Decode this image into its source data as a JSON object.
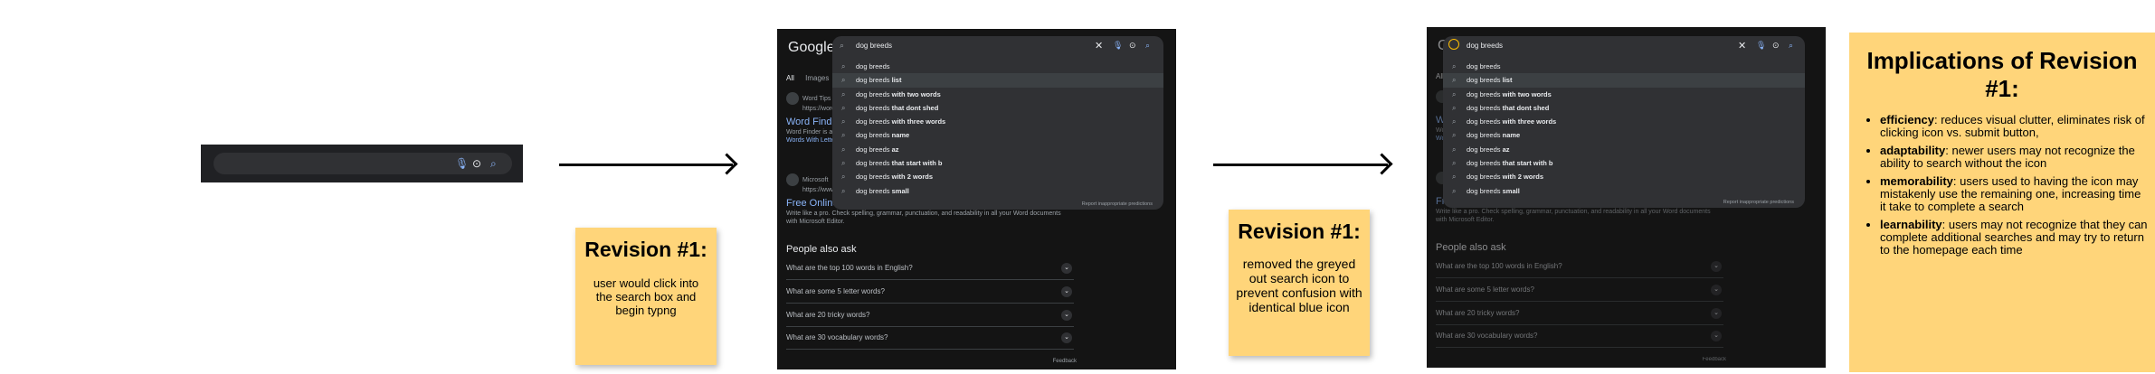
{
  "stage1": {
    "icons": [
      "mic-icon",
      "lens-icon",
      "search-icon"
    ]
  },
  "note1": {
    "heading": "Revision #1:",
    "body": "user would click into the search box and begin typng"
  },
  "note2": {
    "heading": "Revision #1:",
    "body": "removed the greyed out search icon to prevent confusion with identical blue icon"
  },
  "screen": {
    "logo": "Google",
    "query": "dog breeds",
    "tabs": [
      "All",
      "Images"
    ],
    "suggestions": [
      {
        "prefix": "dog breeds",
        "bold": ""
      },
      {
        "prefix": "dog breeds",
        "bold": " list"
      },
      {
        "prefix": "dog breeds",
        "bold": " with two words"
      },
      {
        "prefix": "dog breeds",
        "bold": " that dont shed"
      },
      {
        "prefix": "dog breeds",
        "bold": " with three words"
      },
      {
        "prefix": "dog breeds",
        "bold": " name"
      },
      {
        "prefix": "dog breeds",
        "bold": " az"
      },
      {
        "prefix": "dog breeds",
        "bold": " that start with b"
      },
      {
        "prefix": "dog breeds",
        "bold": " with 2 words"
      },
      {
        "prefix": "dog breeds",
        "bold": " small"
      }
    ],
    "report": "Report inappropriate predictions",
    "result1": {
      "site": "Word Tips",
      "url": "https://word...",
      "title": "Word Finder",
      "snippet": "Word Finder is a ... all possible words ...",
      "link": "Words With Letters"
    },
    "result2": {
      "site": "Microsoft",
      "url": "https://www...",
      "title": "Free Online E...",
      "snippet": "Write like a pro. Check spelling, grammar, punctuation, and readability in all your Word documents with Microsoft Editor."
    },
    "paa_title": "People also ask",
    "questions": [
      "What are the top 100 words in English?",
      "What are some 5 letter words?",
      "What are 20 tricky words?",
      "What are 30 vocabulary words?"
    ],
    "feedback": "Feedback"
  },
  "implications": {
    "heading": "Implications of Revision #1:",
    "items": [
      {
        "term": "efficiency",
        "text": ": reduces visual clutter, eliminates risk of clicking icon vs. submit button,"
      },
      {
        "term": "adaptability",
        "text": ": newer users may not recognize the ability to search without the icon"
      },
      {
        "term": "memorability",
        "text": ": users used to having the icon may mistakenly use the remaining one, increasing time it take to complete a search"
      },
      {
        "term": "learnability",
        "text": ":  users may not recognize that they can complete additional searches and may try to return to the homepage each time"
      }
    ]
  },
  "colors": {
    "note": "#ffd57a",
    "screen_bg": "#141414",
    "dropdown_bg": "#303134",
    "link": "#8ab4f8",
    "mic": "#8ab4f8",
    "lens": "#e8eaed",
    "search_icon": "#8ab4f8"
  }
}
